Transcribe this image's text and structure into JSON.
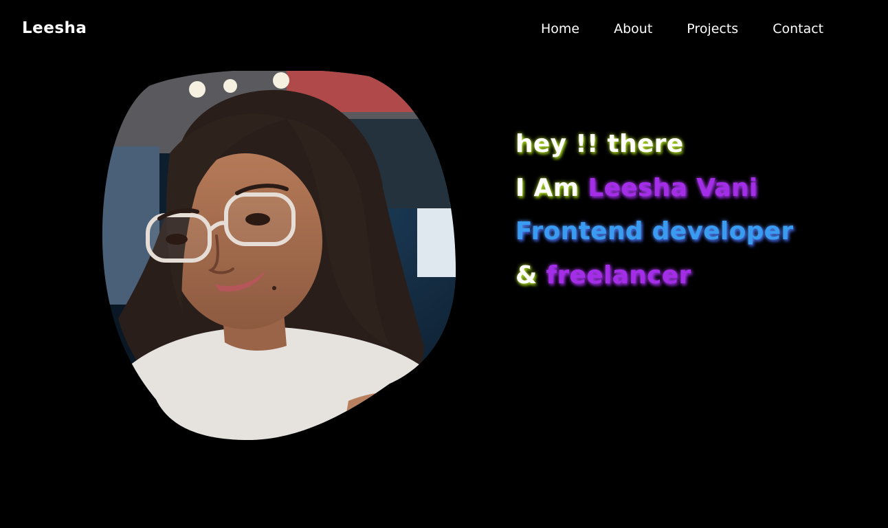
{
  "header": {
    "logo": "Leesha",
    "nav": [
      {
        "label": "Home"
      },
      {
        "label": "About"
      },
      {
        "label": "Projects"
      },
      {
        "label": "Contact"
      }
    ]
  },
  "hero": {
    "line1": "hey !! there",
    "line2_prefix": "I Am ",
    "line2_name": "Leesha Vani",
    "line3": "Frontend developer",
    "line4_prefix": "& ",
    "line4_word": "freelancer"
  },
  "colors": {
    "background": "#000000",
    "text": "#ffffff",
    "accent_purple": "#a42ee8",
    "accent_blue": "#3a9cf0",
    "glow_lime": "#d2ff3c"
  }
}
